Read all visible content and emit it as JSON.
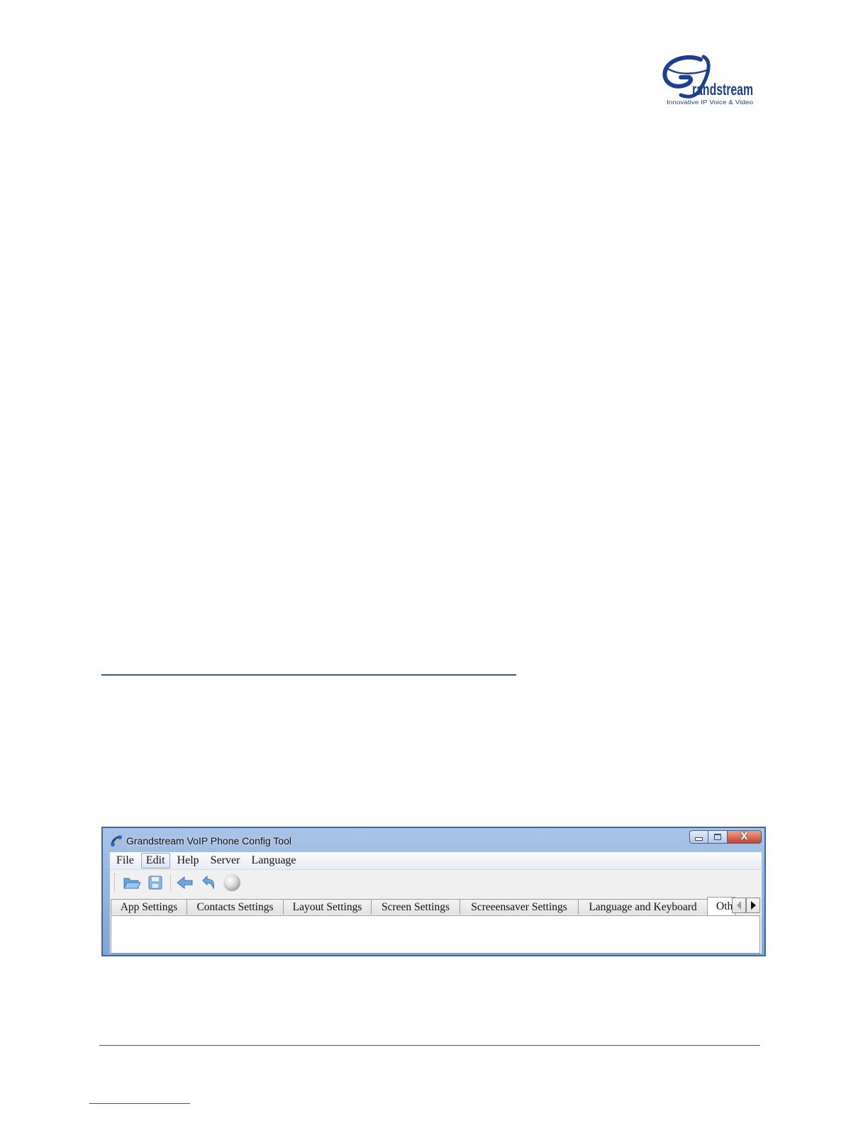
{
  "logo": {
    "brand": "Grandstream",
    "tagline": "Innovative IP Voice & Video",
    "color": "#1e3f8f"
  },
  "window": {
    "title": "Grandstream VoIP Phone Config Tool",
    "buttons": {
      "close_glyph": "X"
    }
  },
  "menu": [
    "File",
    "Edit",
    "Help",
    "Server",
    "Language"
  ],
  "toolbar": {
    "icons": [
      "open-folder-icon",
      "save-icon",
      "back-arrow-icon",
      "undo-icon",
      "sphere-icon"
    ]
  },
  "tabs": [
    "App Settings",
    "Contacts Settings",
    "Layout Settings",
    "Screen Settings",
    "Screeensaver Settings",
    "Language and Keyboard",
    "Oth"
  ],
  "colors": {
    "link_rule": "#2e5b98",
    "window_frame": "#7ea6d6",
    "close_button": "#c7412a"
  }
}
